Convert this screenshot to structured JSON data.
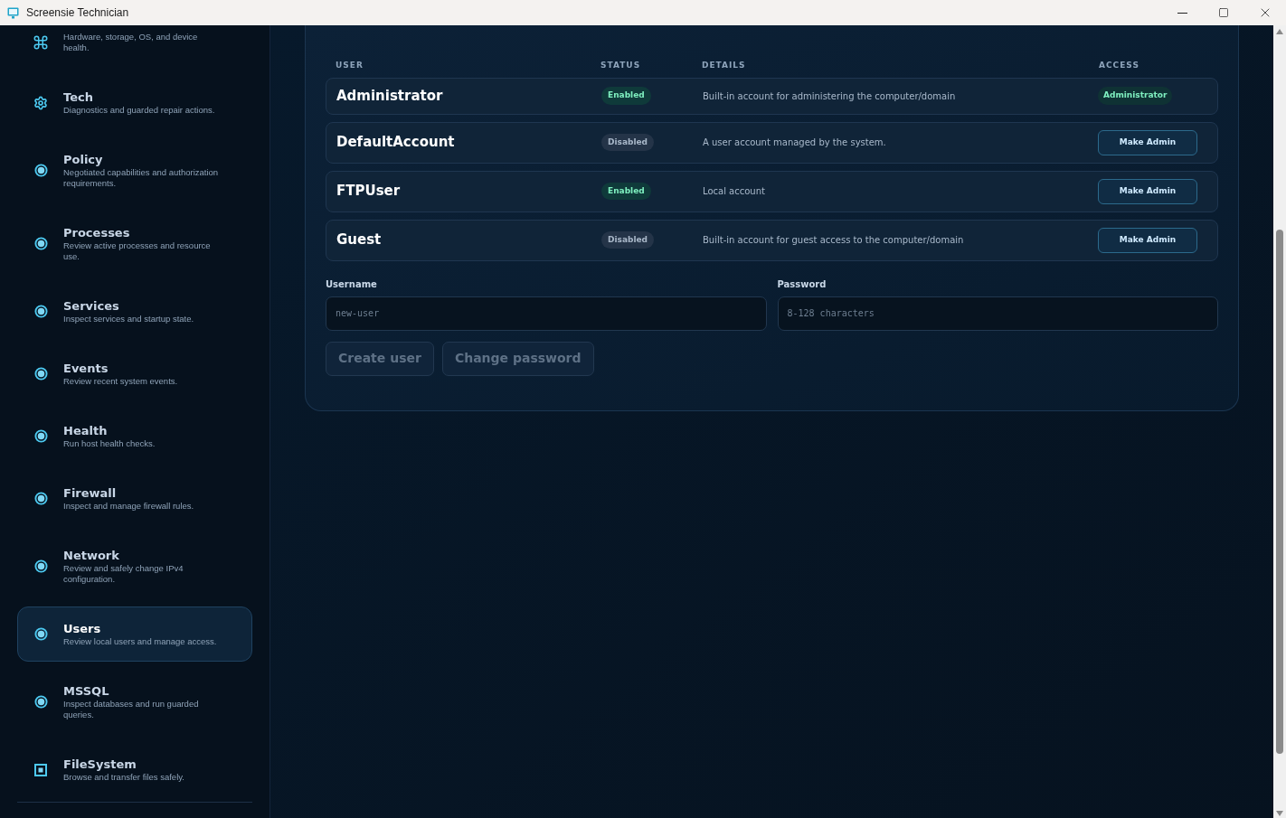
{
  "window": {
    "title": "Screensie Technician"
  },
  "sidebar": {
    "items": [
      {
        "kind": "command",
        "description": "Hardware, storage, OS, and device health.",
        "selected": false
      },
      {
        "kind": "gear",
        "title": "Tech",
        "description": "Diagnostics and guarded repair actions.",
        "selected": false
      },
      {
        "kind": "dot",
        "title": "Policy",
        "description": "Negotiated capabilities and authorization requirements.",
        "selected": false
      },
      {
        "kind": "dot",
        "title": "Processes",
        "description": "Review active processes and resource use.",
        "selected": false
      },
      {
        "kind": "dot",
        "title": "Services",
        "description": "Inspect services and startup state.",
        "selected": false
      },
      {
        "kind": "dot",
        "title": "Events",
        "description": "Review recent system events.",
        "selected": false
      },
      {
        "kind": "dot",
        "title": "Health",
        "description": "Run host health checks.",
        "selected": false
      },
      {
        "kind": "dot",
        "title": "Firewall",
        "description": "Inspect and manage firewall rules.",
        "selected": false
      },
      {
        "kind": "dot",
        "title": "Network",
        "description": "Review and safely change IPv4 configuration.",
        "selected": false
      },
      {
        "kind": "dot",
        "title": "Users",
        "description": "Review local users and manage access.",
        "selected": true
      },
      {
        "kind": "dot",
        "title": "MSSQL",
        "description": "Inspect databases and run guarded queries.",
        "selected": false
      },
      {
        "kind": "square",
        "title": "FileSystem",
        "description": "Browse and transfer files safely.",
        "selected": false
      }
    ]
  },
  "table": {
    "columns": [
      "USER",
      "STATUS",
      "DETAILS",
      "ACCESS"
    ],
    "rows": [
      {
        "user": "Administrator",
        "status": "Enabled",
        "enabled": true,
        "details": "Built-in account for administering the computer/domain",
        "access": {
          "kind": "badge",
          "label": "Administrator"
        }
      },
      {
        "user": "DefaultAccount",
        "status": "Disabled",
        "enabled": false,
        "details": "A user account managed by the system.",
        "access": {
          "kind": "button",
          "label": "Make Admin"
        }
      },
      {
        "user": "FTPUser",
        "status": "Enabled",
        "enabled": true,
        "details": "Local account",
        "access": {
          "kind": "button",
          "label": "Make Admin"
        }
      },
      {
        "user": "Guest",
        "status": "Disabled",
        "enabled": false,
        "details": "Built-in account for guest access to the computer/domain",
        "access": {
          "kind": "button",
          "label": "Make Admin"
        }
      }
    ]
  },
  "form": {
    "fields": [
      {
        "label": "Username",
        "placeholder": "new-user"
      },
      {
        "label": "Password",
        "placeholder": "8-128 characters"
      }
    ],
    "buttons": [
      {
        "label": "Create user",
        "disabled": true
      },
      {
        "label": "Change password",
        "disabled": true
      }
    ]
  }
}
